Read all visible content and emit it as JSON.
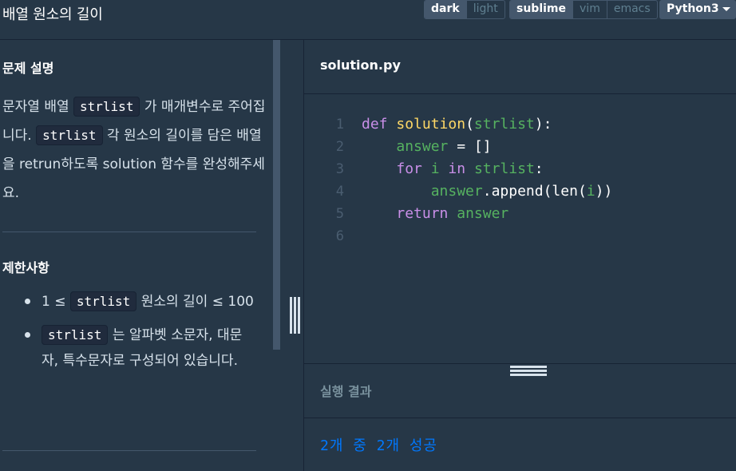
{
  "header": {
    "title": "배열 원소의 길이",
    "theme_options": [
      "dark",
      "light"
    ],
    "theme_selected": "dark",
    "editor_options": [
      "sublime",
      "vim",
      "emacs"
    ],
    "editor_selected": "sublime",
    "language": "Python3"
  },
  "problem": {
    "description_title": "문제 설명",
    "description_parts": {
      "p1": "문자열 배열",
      "code1": "strlist",
      "p2": "가 매개변수로 주어집니다.",
      "code2": "strlist",
      "p3": "각 원소의 길이를 담은 배열을 retrun하도록 solution 함수를 완성해주세요."
    },
    "constraints_title": "제한사항",
    "constraints": [
      {
        "pre": "1 ≤",
        "code": "strlist",
        "post": "원소의 길이 ≤ 100"
      },
      {
        "pre": "",
        "code": "strlist",
        "post": "는 알파벳 소문자, 대문자, 특수문자로 구성되어 있습니다."
      }
    ]
  },
  "editor": {
    "file_name": "solution.py",
    "lines": [
      {
        "num": "1",
        "tokens": [
          [
            "kw",
            "def"
          ],
          [
            "pn",
            " "
          ],
          [
            "fn",
            "solution"
          ],
          [
            "pn",
            "("
          ],
          [
            "var",
            "strlist"
          ],
          [
            "pn",
            "):"
          ]
        ]
      },
      {
        "num": "2",
        "tokens": [
          [
            "pn",
            "    "
          ],
          [
            "var",
            "answer"
          ],
          [
            "pn",
            " = []"
          ]
        ]
      },
      {
        "num": "3",
        "tokens": [
          [
            "pn",
            "    "
          ],
          [
            "kw",
            "for"
          ],
          [
            "pn",
            " "
          ],
          [
            "var",
            "i"
          ],
          [
            "pn",
            " "
          ],
          [
            "kw",
            "in"
          ],
          [
            "pn",
            " "
          ],
          [
            "var",
            "strlist"
          ],
          [
            "pn",
            ":"
          ]
        ]
      },
      {
        "num": "4",
        "tokens": [
          [
            "pn",
            "        "
          ],
          [
            "var",
            "answer"
          ],
          [
            "pn",
            ".append(len("
          ],
          [
            "var",
            "i"
          ],
          [
            "pn",
            "))"
          ]
        ]
      },
      {
        "num": "5",
        "tokens": [
          [
            "pn",
            "    "
          ],
          [
            "kw",
            "return"
          ],
          [
            "pn",
            " "
          ],
          [
            "var",
            "answer"
          ]
        ]
      },
      {
        "num": "6",
        "tokens": []
      }
    ]
  },
  "output": {
    "title": "실행 결과",
    "summary": "2개 중 2개 성공"
  }
}
